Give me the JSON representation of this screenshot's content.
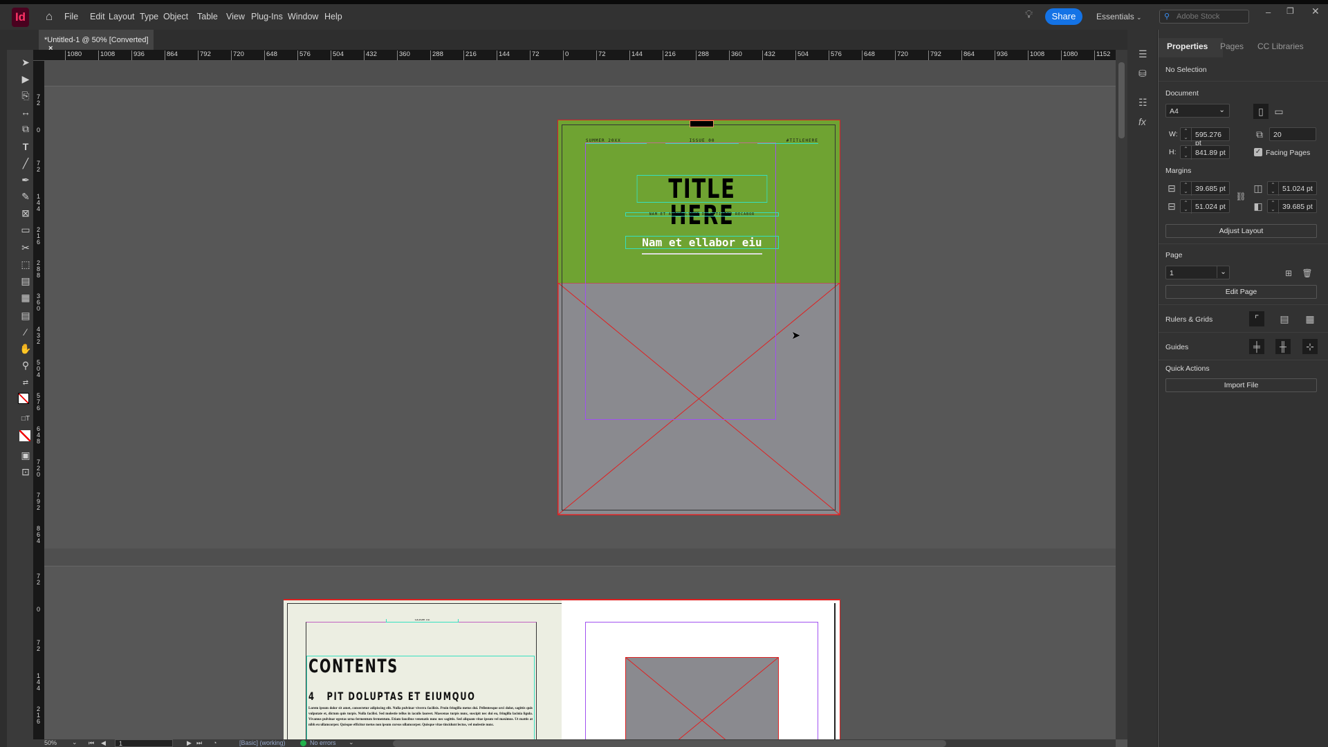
{
  "app": {
    "logo": "Id",
    "menu": [
      "File",
      "Edit",
      "Layout",
      "Type",
      "Object",
      "Table",
      "View",
      "Plug-Ins",
      "Window",
      "Help"
    ],
    "share": "Share",
    "workspace": "Essentials",
    "search_placeholder": "Adobe Stock"
  },
  "document_tab": {
    "title": "*Untitled-1 @ 50% [Converted]",
    "close": "×"
  },
  "rulers": {
    "horizontal": [
      "1080",
      "1008",
      "936",
      "864",
      "792",
      "720",
      "648",
      "576",
      "504",
      "432",
      "360",
      "288",
      "216",
      "144",
      "72",
      "0",
      "72",
      "144",
      "216",
      "288",
      "360",
      "432",
      "504",
      "576",
      "648",
      "720",
      "792",
      "864",
      "936",
      "1008",
      "1080",
      "1152"
    ],
    "vertical": [
      "72",
      "0",
      "72",
      "144",
      "216",
      "288",
      "360",
      "432",
      "504",
      "576",
      "648",
      "720",
      "792",
      "864",
      "72",
      "0",
      "72",
      "144",
      "216"
    ]
  },
  "page1": {
    "header_left": "SUMMER 20XX",
    "header_center": "ISSUE 00",
    "header_right": "#TITLEHERE",
    "title": "TITLE HERE",
    "tagline": "NAM ET ANTUR LIBUS DOLUPTISTEM RECABOR",
    "subtitle": "Nam et ellabor eiu",
    "colors": {
      "cover": "#6fa332",
      "frame": "#8a8a8f",
      "guide": "#35e0c0",
      "margin": "#a050f0",
      "bleed": "#e02020"
    }
  },
  "page2": {
    "issue": "ISSUE 02",
    "heading": "CONTENTS",
    "item_number": "4",
    "item_title": "PIT DOLUPTAS ET EIUMQUO",
    "body": "Lorem ipsum dolor sit amet, consectetur adipiscing elit. Nulla pulvinar viverra facilisis. Proin fringilla metus dui. Pellentesque orci dolor, sagittis quis vulputate et, dictum quis turpis. Nulla facilisi. Sed molestie tellus in iaculis laoreet. Maecenas turpis nunc, suscipit nec dui eu, fringilla lacinia ligula. Vivamus pulvinar egestas urna fermentum fermentum. Etiam faucibus venenatis nunc nec sagittis. Sed aliquam vitae ipsum vel maximus. Ut mattis at nibh eu ullamcorper. Quisque efficitur metus non ipsum cursus ullamcorper. Quisque vitae tincidunt lectus, vel molestie nunc."
  },
  "panel": {
    "tabs": [
      "Properties",
      "Pages",
      "CC Libraries"
    ],
    "selection": "No Selection",
    "document_label": "Document",
    "preset": "A4",
    "w_label": "W:",
    "width": "595.276 pt",
    "h_label": "H:",
    "height": "841.89 pt",
    "pages_count": "20",
    "facing_pages": "Facing Pages",
    "facing_pages_checked": true,
    "margins_label": "Margins",
    "margin_top": "39.685 pt",
    "margin_bottom": "51.024 pt",
    "margin_inside": "51.024 pt",
    "margin_outside": "39.685 pt",
    "adjust_layout": "Adjust Layout",
    "page_label": "Page",
    "page_value": "1",
    "edit_page": "Edit Page",
    "rulers_grids": "Rulers & Grids",
    "guides": "Guides",
    "quick_actions": "Quick Actions",
    "import_file": "Import File"
  },
  "status": {
    "zoom": "50%",
    "page": "1",
    "preflight_profile": "[Basic] (working)",
    "errors": "No errors",
    "error_color": "#22b24c"
  }
}
